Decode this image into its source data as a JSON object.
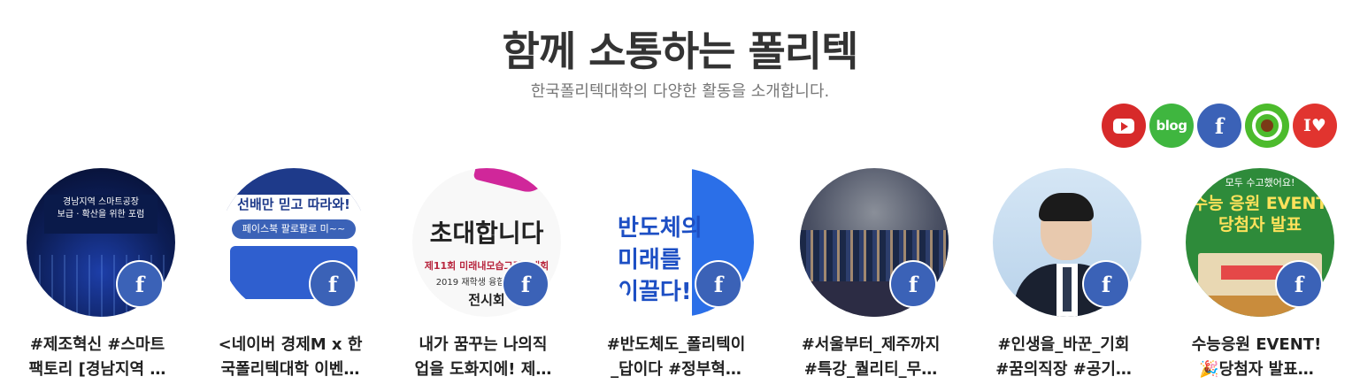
{
  "header": {
    "title": "함께 소통하는 폴리텍",
    "subtitle": "한국폴리텍대학의 다양한 활동을 소개합니다."
  },
  "social": [
    {
      "name": "youtube",
      "icon": "youtube-icon",
      "label": "",
      "color": "#d72a2a"
    },
    {
      "name": "blog",
      "icon": "blog-icon",
      "label": "blog",
      "color": "#3fb63f"
    },
    {
      "name": "facebook",
      "icon": "facebook-icon",
      "label": "f",
      "color": "#3b62b7"
    },
    {
      "name": "instagram",
      "icon": "instagram-icon",
      "label": "",
      "color": "#4cbb2c"
    },
    {
      "name": "iloveschool",
      "icon": "i-love-icon",
      "label": "I♥",
      "color": "#e1342f"
    }
  ],
  "posts": [
    {
      "badge": "f",
      "caption_line1": "#제조혁신 #스마트",
      "caption_line2": "팩토리 [경남지역 …",
      "thumb_text": [
        "경남지역 스마트공장",
        "보급 · 확산을 위한 포럼"
      ]
    },
    {
      "badge": "f",
      "caption_line1": "<네이버 경제M x 한",
      "caption_line2": "국폴리텍대학 이벤…",
      "thumb_text": [
        "선배만 믿고 따라와!",
        "페이스북 팔로팔로 미~~"
      ]
    },
    {
      "badge": "f",
      "caption_line1": "내가 꿈꾸는 나의직",
      "caption_line2": "업을 도화지에! 제…",
      "thumb_text": [
        "초대합니다",
        "제11회 미래내모습그리기대회",
        "2019 재학생 융합프로젝트",
        "전시회"
      ]
    },
    {
      "badge": "f",
      "caption_line1": "#반도체도_폴리텍이",
      "caption_line2": "_답이다 #정부혁…",
      "thumb_text": [
        "반도체의",
        "미래를",
        "이끌다!"
      ]
    },
    {
      "badge": "f",
      "caption_line1": "#서울부터_제주까지",
      "caption_line2": "#특강_퀄리티_무…",
      "thumb_text": []
    },
    {
      "badge": "f",
      "caption_line1": "#인생을_바꾼_기회",
      "caption_line2": "#꿈의직장 #공기…",
      "thumb_text": []
    },
    {
      "badge": "f",
      "caption_line1": "수능응원 EVENT!",
      "caption_line2": "🎉당첨자 발표…",
      "thumb_text": [
        "모두 수고했어요!",
        "수능 응원 EVENT",
        "당첨자 발표"
      ]
    }
  ]
}
